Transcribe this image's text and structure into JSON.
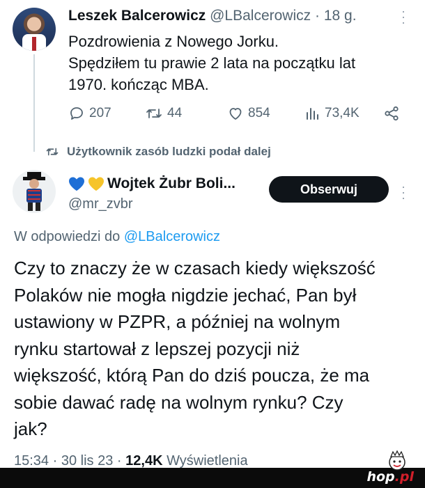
{
  "tweet1": {
    "author_name": "Leszek Balcerowicz",
    "author_handle": "@LBalcerowicz",
    "separator": "·",
    "time_ago": "18 g.",
    "text_lines": [
      "Pozdrowienia z Nowego Jorku.",
      "Spędziłem tu prawie 2 lata na początku lat",
      "1970. kończąc MBA."
    ],
    "actions": {
      "replies": "207",
      "retweets": "44",
      "likes": "854",
      "views": "73,4K"
    }
  },
  "retweet_banner": {
    "text": "Użytkownik zasób ludzki podał dalej"
  },
  "tweet2": {
    "author_name": "Wojtek Żubr Boli...",
    "author_handle": "@mr_zvbr",
    "follow_label": "Obserwuj",
    "reply_prefix": "W odpowiedzi do",
    "reply_mention": "@LBalcerowicz",
    "text_lines": [
      "Czy to znaczy że w czasach kiedy większość",
      "Polaków nie mogła nigdzie jechać, Pan był",
      "ustawiony w PZPR, a później na wolnym",
      "rynku startował z lepszej pozycji niż",
      "większość, którą Pan do dziś poucza, że ma",
      "sobie dawać radę na wolnym rynku? Czy",
      "jak?"
    ],
    "time": "15:34",
    "date": "30 lis 23",
    "views_count": "12,4K",
    "views_label": "Wyświetlenia",
    "dot": "·"
  },
  "watermark": {
    "text_main": "hop",
    "text_suffix": ".pl"
  },
  "colors": {
    "text": "#0f1419",
    "muted": "#536471",
    "link": "#1d9bf0",
    "follow_bg": "#0f1419",
    "heart_blue": "#1f6fd6",
    "heart_yellow": "#f6c42a"
  }
}
